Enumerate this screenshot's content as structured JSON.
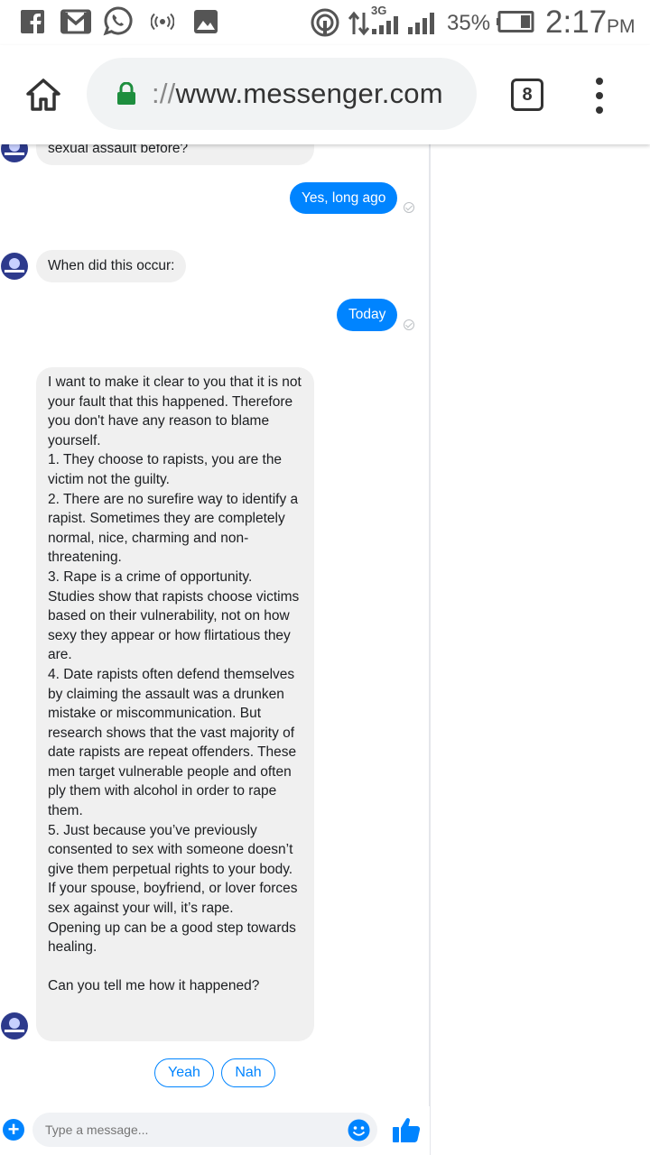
{
  "status_bar": {
    "battery_percent": "35%",
    "network_type": "3G",
    "time": "2:17",
    "ampm": "PM",
    "left_icons": [
      "facebook-icon",
      "gmail-icon",
      "whatsapp-icon",
      "broadcast-icon",
      "gallery-icon"
    ],
    "right_icons": [
      "hotspot-icon",
      "data-arrows-icon",
      "signal-icon",
      "signal-icon",
      "battery-icon"
    ]
  },
  "browser": {
    "url_scheme": "://",
    "url_host": "www.messenger.com",
    "tab_count": "8",
    "icons": [
      "home-icon",
      "lock-icon",
      "more-vert-icon"
    ]
  },
  "chat": {
    "top_partial_message": "sexual assault before?",
    "outgoing_1": "Yes, long ago",
    "incoming_1": "When did this occur:",
    "outgoing_2": "Today",
    "long_message": [
      "I want to make it clear to you that it is not your fault that this happened. Therefore you don't have any reason to blame yourself.",
      "1. They choose to rapists, you are the victim not the guilty.",
      "2. There are no surefire way to identify a rapist. Sometimes they are completely normal, nice, charming and non-threatening.",
      "3. Rape is a crime of opportunity. Studies show that rapists choose victims based on their vulnerability, not on how sexy they appear or how flirtatious they are.",
      "4. Date rapists often defend themselves by claiming the assault was a drunken mistake or miscommunication. But research shows that the vast majority of date rapists are repeat offenders. These men target vulnerable people and often ply them with alcohol in order to rape them.",
      "5. Just because you’ve previously consented to sex with someone doesn’t give them perpetual rights to your body. If your spouse, boyfriend, or lover forces sex against your will, it’s rape.",
      "Opening up can be a good step towards healing."
    ],
    "question": "Can you tell me how it happened?",
    "quick_replies": [
      "Yeah",
      "Nah"
    ]
  },
  "composer": {
    "placeholder": "Type a message...",
    "icons": [
      "plus-icon",
      "emoji-icon",
      "thumbs-up-icon"
    ]
  },
  "colors": {
    "messenger_blue": "#0084ff",
    "incoming_bubble": "#f0f0f0",
    "avatar": "#2d3a8c",
    "lock_green": "#1e8e3e"
  }
}
